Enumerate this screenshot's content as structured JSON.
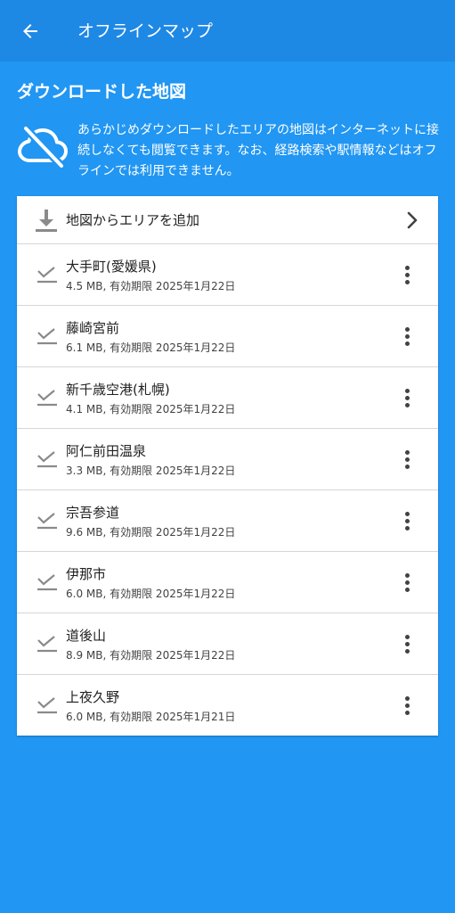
{
  "appbar": {
    "title": "オフラインマップ",
    "back_icon": "arrow-left-icon"
  },
  "section": {
    "title": "ダウンロードした地図",
    "info_icon": "cloud-off-icon",
    "info_text": "あらかじめダウンロードしたエリアの地図はインターネットに接続しなくても閲覧できます。なお、経路検索や駅情報などはオフラインでは利用できません。"
  },
  "add_area": {
    "label": "地図からエリアを追加",
    "icon": "download-icon",
    "chevron_icon": "chevron-right-icon"
  },
  "maps": [
    {
      "name": "大手町(愛媛県)",
      "meta": "4.5 MB, 有効期限 2025年1月22日"
    },
    {
      "name": "藤崎宮前",
      "meta": "6.1 MB, 有効期限 2025年1月22日"
    },
    {
      "name": "新千歳空港(札幌)",
      "meta": "4.1 MB, 有効期限 2025年1月22日"
    },
    {
      "name": "阿仁前田温泉",
      "meta": "3.3 MB, 有効期限 2025年1月22日"
    },
    {
      "name": "宗吾参道",
      "meta": "9.6 MB, 有効期限 2025年1月22日"
    },
    {
      "name": "伊那市",
      "meta": "6.0 MB, 有効期限 2025年1月22日"
    },
    {
      "name": "道後山",
      "meta": "8.9 MB, 有効期限 2025年1月22日"
    },
    {
      "name": "上夜久野",
      "meta": "6.0 MB, 有効期限 2025年1月21日"
    }
  ],
  "colors": {
    "background": "#2196F3",
    "appbar": "#1E88E5",
    "card": "#ffffff",
    "icon_gray": "#8a8a8a"
  }
}
